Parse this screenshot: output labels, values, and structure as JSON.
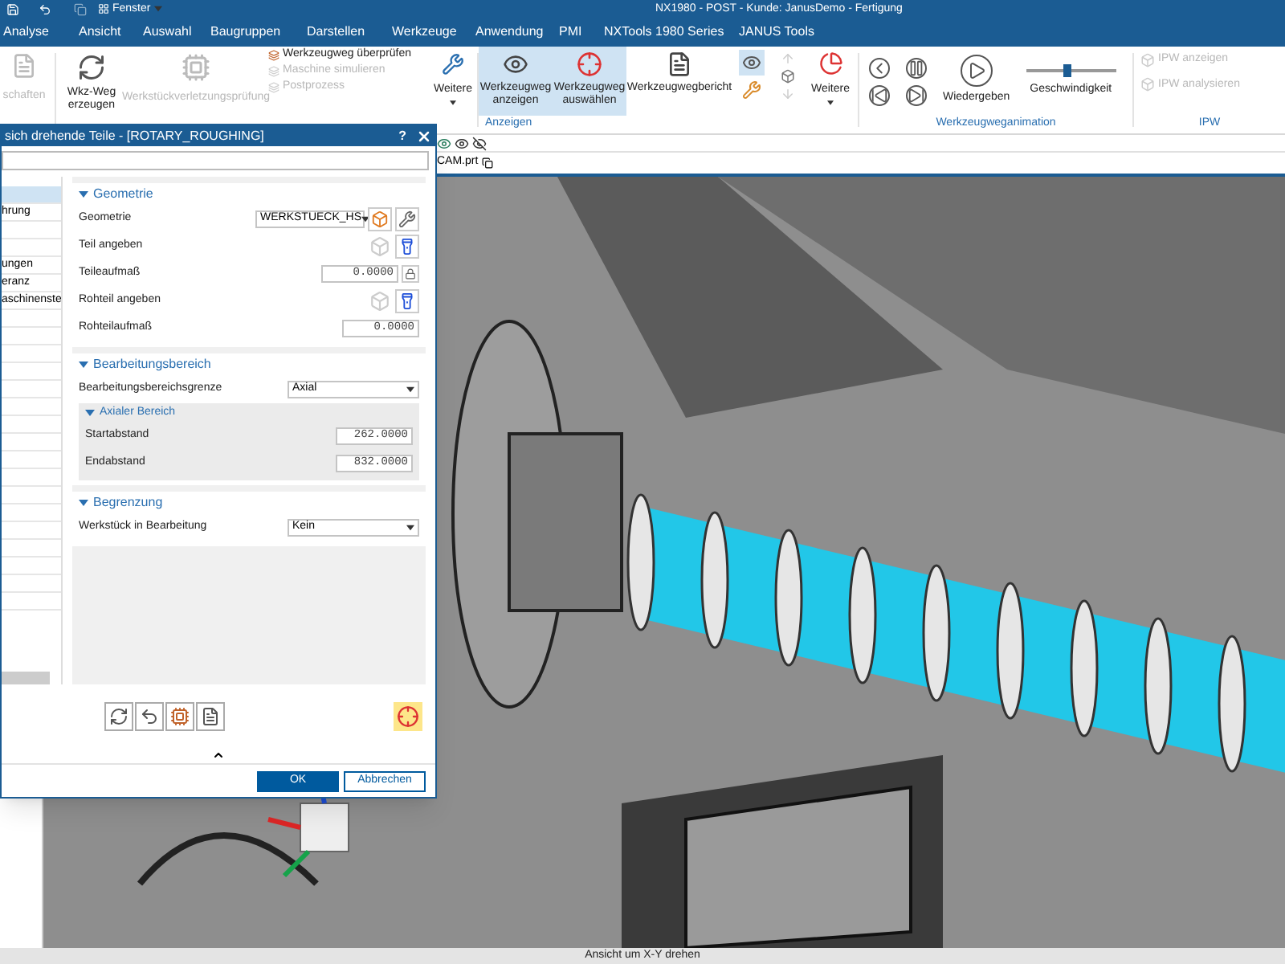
{
  "title_bar": {
    "menu_button": "Fenster",
    "title": "NX1980 - POST - Kunde: JanusDemo - Fertigung"
  },
  "menu_tabs": [
    {
      "label": "Analyse",
      "selected": false
    },
    {
      "label": "Ansicht",
      "selected": false
    },
    {
      "label": "Auswahl",
      "selected": false
    },
    {
      "label": "Baugruppen",
      "selected": false
    },
    {
      "label": "Darstellen",
      "selected": false
    },
    {
      "label": "Werkzeuge",
      "selected": false
    },
    {
      "label": "Anwendung",
      "selected": false
    },
    {
      "label": "PMI",
      "selected": false
    },
    {
      "label": "NXTools 1980 Series",
      "selected": false
    },
    {
      "label": "JANUS Tools",
      "selected": false
    }
  ],
  "ribbon": {
    "properties": {
      "label": "schaften",
      "disabled": true
    },
    "operations": {
      "create": {
        "label": "Wkz-Weg erzeugen",
        "disabled": false
      },
      "check": {
        "label": "Werkstückverletzungsprüfung",
        "disabled": true
      },
      "stack": [
        {
          "label": "Werkzeugweg überprüfen",
          "disabled": false
        },
        {
          "label": "Maschine simulieren",
          "disabled": true
        },
        {
          "label": "Postprozess",
          "disabled": true
        }
      ],
      "more": {
        "label": "Weitere"
      }
    },
    "display": {
      "label": "Anzeigen",
      "buttons": [
        {
          "label": "Werkzeugweg anzeigen",
          "selected": true
        },
        {
          "label": "Werkzeugweg auswählen",
          "selected": true
        },
        {
          "label": "Werkzeugwegbericht",
          "selected": false
        }
      ],
      "toggle": {
        "selected": true
      },
      "more": {
        "label": "Weitere"
      }
    },
    "animation": {
      "label": "Werkzeugweganimation",
      "play": "Wiedergeben",
      "speed": {
        "label": "Geschwindigkeit",
        "level": 0.45
      }
    },
    "ipw": {
      "label": "IPW",
      "items": [
        {
          "label": "IPW anzeigen",
          "disabled": true
        },
        {
          "label": "IPW analysieren",
          "disabled": true
        }
      ]
    }
  },
  "file_tab": {
    "label": "CAM.prt"
  },
  "dialog": {
    "title": "sich drehende Teile - [ROTARY_ROUGHING]",
    "help": "?",
    "nav_list": [
      {
        "selected": true
      },
      {
        "label": "hrung",
        "selected": false
      },
      {
        "selected": false
      },
      {
        "selected": false
      },
      {
        "label": "ungen",
        "selected": false
      },
      {
        "label": "eranz",
        "selected": false
      },
      {
        "label": "aschinenste",
        "selected": false
      }
    ],
    "sections": [
      {
        "title": "Geometrie",
        "expanded": true,
        "rows": [
          {
            "kind": "select_actions",
            "label": "Geometrie",
            "value": "WERKSTUECK_HS"
          },
          {
            "kind": "pick",
            "label": "Teil angeben"
          },
          {
            "kind": "number_lock",
            "label": "Teileaufmaß",
            "value": "0.0000"
          },
          {
            "kind": "pick",
            "label": "Rohteil angeben"
          },
          {
            "kind": "number",
            "label": "Rohteilaufmaß",
            "value": "0.0000"
          }
        ]
      },
      {
        "title": "Bearbeitungsbereich",
        "expanded": true,
        "rows": [
          {
            "kind": "select",
            "label": "Bearbeitungsbereichsgrenze",
            "value": "Axial"
          },
          {
            "kind": "group",
            "title": "Axialer Bereich",
            "expanded": true,
            "rows": [
              {
                "kind": "number",
                "label": "Startabstand",
                "value": "262.0000"
              },
              {
                "kind": "number",
                "label": "Endabstand",
                "value": "832.0000"
              }
            ]
          }
        ]
      },
      {
        "title": "Begrenzung",
        "expanded": true,
        "rows": [
          {
            "kind": "select",
            "label": "Werkstück in Bearbeitung",
            "value": "Kein"
          }
        ]
      }
    ],
    "buttons": [
      {
        "label": "OK",
        "kind": "primary"
      },
      {
        "label": "Abbrechen",
        "kind": "secondary"
      }
    ]
  },
  "status_bar": {
    "text": "Ansicht um X-Y drehen"
  }
}
